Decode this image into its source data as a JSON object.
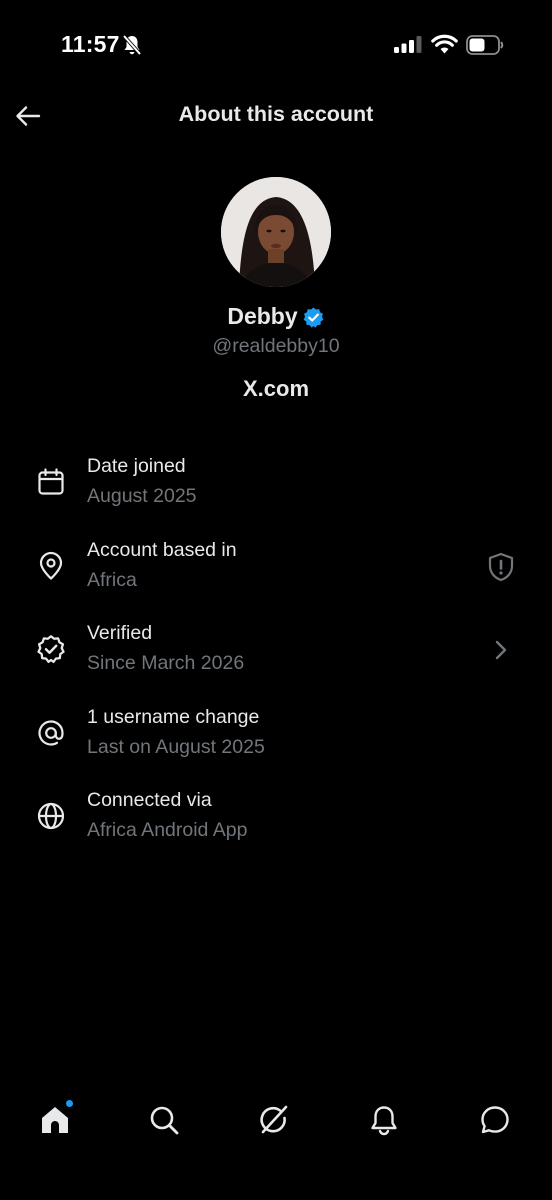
{
  "status_bar": {
    "time": "11:57",
    "icons": [
      "bell-slash-icon",
      "signal-icon",
      "wifi-icon",
      "battery-icon"
    ]
  },
  "header": {
    "title": "About this account",
    "back_icon": "arrow-left-icon"
  },
  "profile": {
    "name": "Debby",
    "handle": "@realdebby10",
    "domain": "X.com",
    "verified_color": "#1d9bf0"
  },
  "info_rows": [
    {
      "icon": "calendar-icon",
      "title": "Date joined",
      "subtitle": "August 2025",
      "trailing": ""
    },
    {
      "icon": "location-pin-icon",
      "title": "Account based in",
      "subtitle": "Africa",
      "trailing": "shield-icon"
    },
    {
      "icon": "verified-badge-outline-icon",
      "title": "Verified",
      "subtitle": "Since March 2026",
      "trailing": "chevron-right-icon"
    },
    {
      "icon": "at-sign-icon",
      "title": "1 username change",
      "subtitle": "Last on August 2025",
      "trailing": ""
    },
    {
      "icon": "globe-icon",
      "title": "Connected via",
      "subtitle": "Africa Android App",
      "trailing": ""
    }
  ],
  "bottom_nav": {
    "items": [
      "home-icon",
      "search-icon",
      "grok-icon",
      "notifications-icon",
      "messages-icon"
    ],
    "active": "home-icon",
    "notification_dot_color": "#1d9bf0"
  },
  "colors": {
    "background": "#000000",
    "primary_text": "#e7e9ea",
    "secondary_text": "#71767b",
    "accent": "#1d9bf0"
  }
}
